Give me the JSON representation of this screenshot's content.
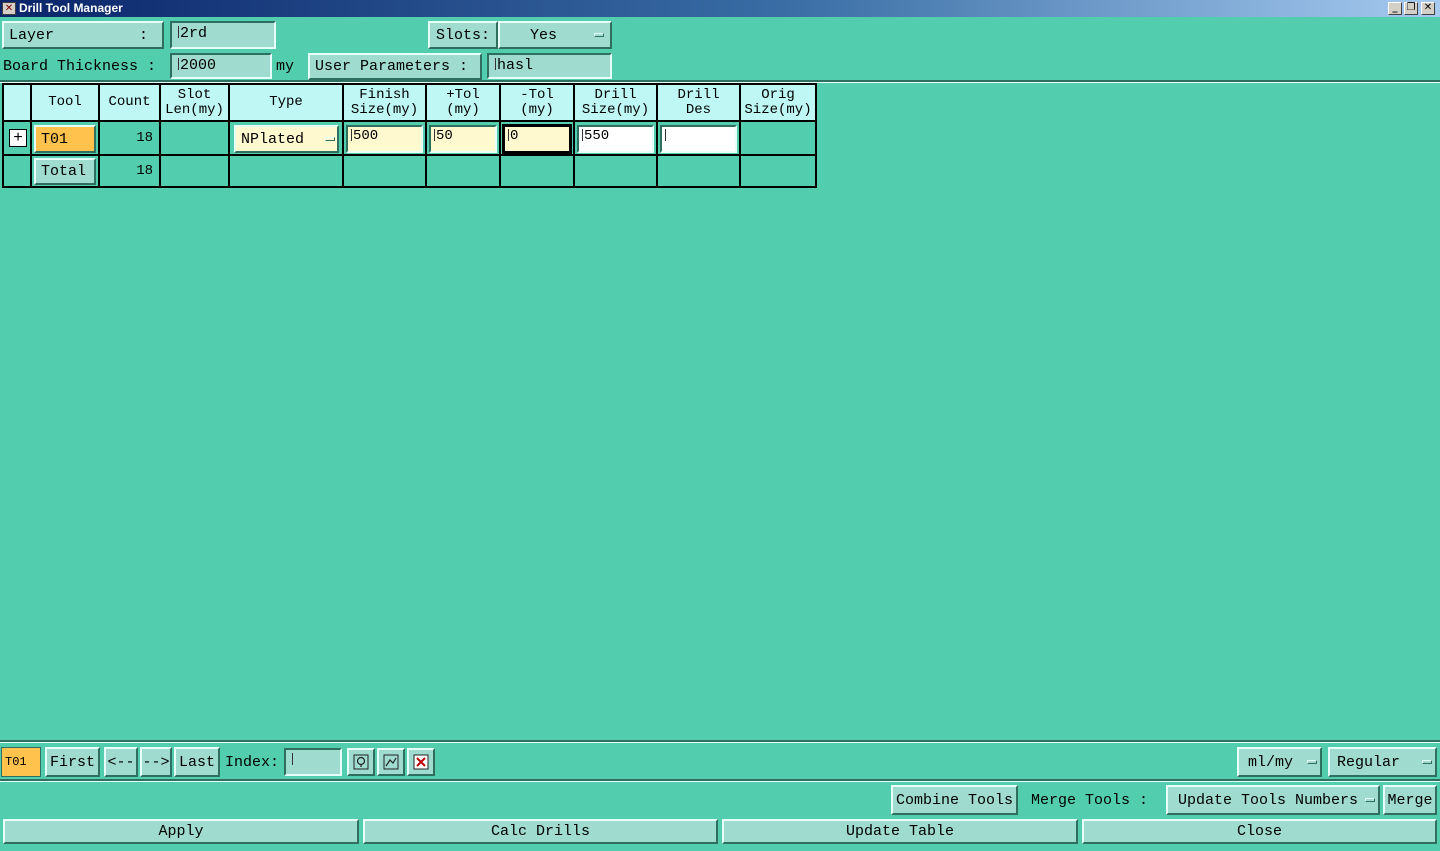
{
  "window": {
    "title": "Drill Tool Manager"
  },
  "header": {
    "layer_label": "Layer",
    "layer_colon": ":",
    "layer_value": "2rd",
    "slots_label": "Slots:",
    "slots_value": "Yes",
    "board_thickness_label": "Board Thickness  :",
    "board_thickness_value": "2000",
    "board_thickness_unit": "my",
    "user_params_label": "User Parameters  :",
    "user_params_value": "hasl"
  },
  "table": {
    "headers": {
      "tool": "Tool",
      "count": "Count",
      "slot_len_1": "Slot",
      "slot_len_2": "Len(my)",
      "type": "Type",
      "finish_1": "Finish",
      "finish_2": "Size(my)",
      "ptol_1": "+Tol",
      "ptol_2": "(my)",
      "mtol_1": "-Tol",
      "mtol_2": "(my)",
      "drill_1": "Drill",
      "drill_2": "Size(my)",
      "des_1": "Drill",
      "des_2": "Des",
      "orig_1": "Orig",
      "orig_2": "Size(my)"
    },
    "rows": [
      {
        "tool": "T01",
        "count": "18",
        "slot_len": "",
        "type": "NPlated",
        "finish_size": "500",
        "plus_tol": "50",
        "minus_tol": "0",
        "drill_size": "550",
        "drill_des": "",
        "orig_size": ""
      }
    ],
    "total": {
      "label": "Total",
      "count": "18"
    }
  },
  "nav": {
    "current_tool": "T01",
    "first": "First",
    "prev": "<--",
    "next": "-->",
    "last": "Last",
    "index_label": "Index:",
    "index_value": "",
    "units": "ml/my",
    "mode": "Regular"
  },
  "actions": {
    "combine_tools": "Combine Tools",
    "merge_tools_label": "Merge Tools  :",
    "merge_option": "Update Tools Numbers",
    "merge": "Merge",
    "apply": "Apply",
    "calc_drills": "Calc Drills",
    "update_table": "Update Table",
    "close": "Close"
  },
  "colors": {
    "background": "#52cdad",
    "header_cell": "#bff7f5",
    "tool_highlight": "#ffc34d",
    "input_field": "#fff9d0"
  }
}
